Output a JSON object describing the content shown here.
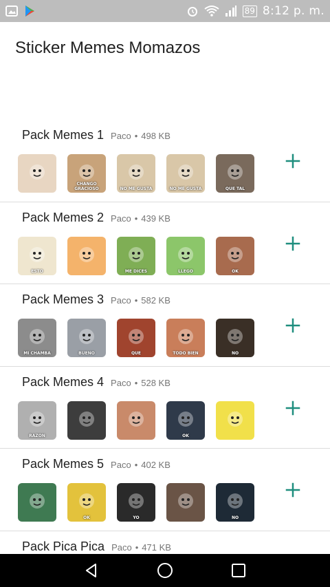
{
  "status_bar": {
    "time": "8:12 p. m.",
    "battery": "89"
  },
  "app": {
    "title": "Sticker Memes Momazos"
  },
  "packs": [
    {
      "name": "Pack Memes 1",
      "author": "Paco",
      "separator": "•",
      "size": "498 KB",
      "stickers": [
        {
          "icon": "monkey-sticker",
          "color": "#e8d6c2",
          "caption": ""
        },
        {
          "icon": "woody-sticker",
          "color": "#c8a37a",
          "caption": "CHANGO GRACIOSO"
        },
        {
          "icon": "cartoon-sticker",
          "color": "#d9c7a8",
          "caption": "NO ME GUSTA"
        },
        {
          "icon": "cartoon-sticker",
          "color": "#d9c7a8",
          "caption": "NO ME GUSTA"
        },
        {
          "icon": "hippo-sticker",
          "color": "#7a6a5c",
          "caption": "QUE TAL"
        }
      ]
    },
    {
      "name": "Pack Memes 2",
      "author": "Paco",
      "separator": "•",
      "size": "439 KB",
      "stickers": [
        {
          "icon": "comic-sticker",
          "color": "#efe6cf",
          "caption": "ESTO"
        },
        {
          "icon": "powerpuff-sticker",
          "color": "#f4b36b",
          "caption": ""
        },
        {
          "icon": "frog-sticker",
          "color": "#7fae55",
          "caption": "ME DICES"
        },
        {
          "icon": "powerpuff-sticker",
          "color": "#8cc66a",
          "caption": "LLEGO"
        },
        {
          "icon": "girl-sticker",
          "color": "#a86b4e",
          "caption": "OK"
        }
      ]
    },
    {
      "name": "Pack Memes 3",
      "author": "Paco",
      "separator": "•",
      "size": "582 KB",
      "stickers": [
        {
          "icon": "man-sticker",
          "color": "#8c8c8c",
          "caption": "MI CHAMBA"
        },
        {
          "icon": "man-sticker",
          "color": "#9a9fa6",
          "caption": "BUENO"
        },
        {
          "icon": "man-sticker",
          "color": "#a0442e",
          "caption": "QUE"
        },
        {
          "icon": "girl-sticker",
          "color": "#c97e5a",
          "caption": "TODO BIEN"
        },
        {
          "icon": "man-sticker",
          "color": "#3a2f26",
          "caption": "NO"
        }
      ]
    },
    {
      "name": "Pack Memes 4",
      "author": "Paco",
      "separator": "•",
      "size": "528 KB",
      "stickers": [
        {
          "icon": "man-sticker",
          "color": "#b0b0b0",
          "caption": "RAZON"
        },
        {
          "icon": "man-sticker",
          "color": "#3d3d3d",
          "caption": ""
        },
        {
          "icon": "girl-sticker",
          "color": "#c98a6a",
          "caption": ""
        },
        {
          "icon": "man-sticker",
          "color": "#2f3a4a",
          "caption": "OK"
        },
        {
          "icon": "spongebob-sticker",
          "color": "#f1e04a",
          "caption": ""
        }
      ]
    },
    {
      "name": "Pack Memes 5",
      "author": "Paco",
      "separator": "•",
      "size": "402 KB",
      "stickers": [
        {
          "icon": "man-sticker",
          "color": "#3f7a52",
          "caption": ""
        },
        {
          "icon": "simpsons-sticker",
          "color": "#e3c23c",
          "caption": "OK"
        },
        {
          "icon": "dark-sticker",
          "color": "#2a2a2a",
          "caption": "YO"
        },
        {
          "icon": "man-sticker",
          "color": "#6a5446",
          "caption": ""
        },
        {
          "icon": "man-sticker",
          "color": "#1e2a36",
          "caption": "NO"
        }
      ]
    },
    {
      "name": "Pack Pica Pica",
      "author": "Paco",
      "separator": "•",
      "size": "471 KB",
      "stickers": []
    }
  ],
  "accent_color": "#1e8e7e"
}
